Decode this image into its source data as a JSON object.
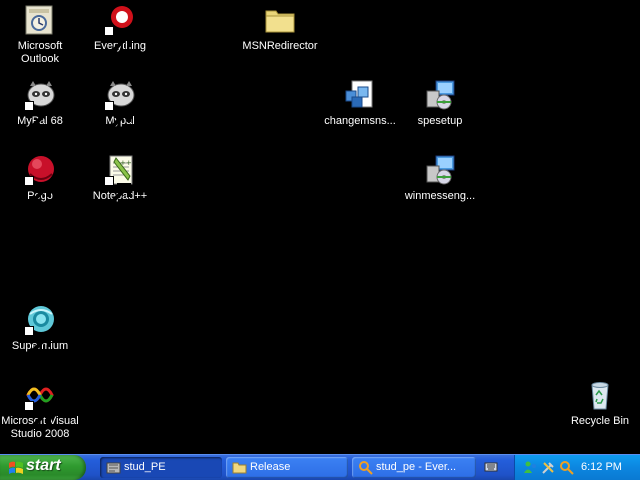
{
  "desktop": {
    "icons": [
      {
        "label": "Microsoft\nOutlook"
      },
      {
        "label": "Everything"
      },
      {
        "label": "MSNRedirector"
      },
      {
        "label": "MyPal 68"
      },
      {
        "label": "Mypal"
      },
      {
        "label": "changemsns..."
      },
      {
        "label": "spesetup"
      },
      {
        "label": "Pego"
      },
      {
        "label": "Notepad++"
      },
      {
        "label": "winmesseng..."
      },
      {
        "label": "Supermium"
      },
      {
        "label": "Microsoft Visual\nStudio 2008"
      },
      {
        "label": "Recycle Bin"
      }
    ]
  },
  "taskbar": {
    "start_label": "start",
    "tasks": [
      {
        "label": "stud_PE",
        "active": true
      },
      {
        "label": "Release",
        "active": false
      },
      {
        "label": "stud_pe - Ever...",
        "active": false
      }
    ],
    "clock": "6:12 PM"
  },
  "colors": {
    "desktop_background": "#000000",
    "taskbar_blue": "#245edb",
    "start_green": "#2f9a2f",
    "tray_blue": "#0c86e0"
  }
}
